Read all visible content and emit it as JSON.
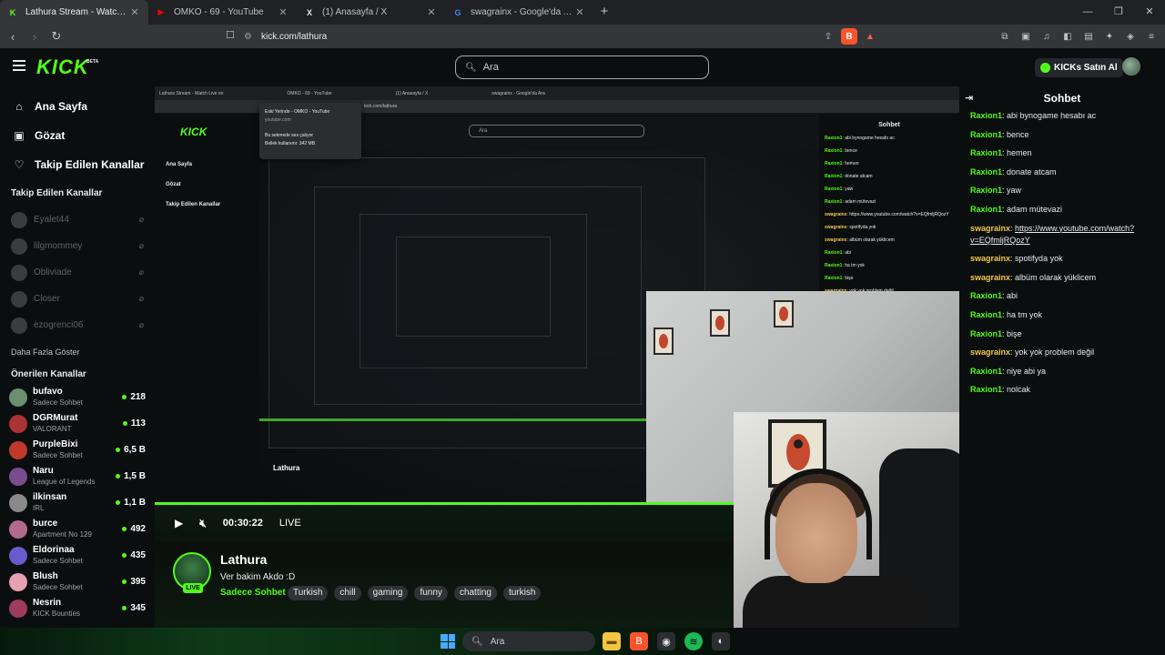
{
  "browser": {
    "tabs": [
      {
        "title": "Lathura Stream - Watch Live on",
        "favicon": "K",
        "color": "#53fc18"
      },
      {
        "title": "OMKO - 69 - YouTube",
        "favicon": "▶",
        "color": "#ff0000"
      },
      {
        "title": "(1) Anasayfa / X",
        "favicon": "X",
        "color": "#e8eaed"
      },
      {
        "title": "swagrainx - Google'da Ara",
        "favicon": "G",
        "color": "#4285f4"
      }
    ],
    "url": "kick.com/lathura"
  },
  "header": {
    "logo": "KICK",
    "beta": "BETA",
    "search_placeholder": "Ara",
    "buy_kicks": "KICKs Satın Al"
  },
  "sidebar": {
    "nav": [
      {
        "label": "Ana Sayfa",
        "icon": "home-icon"
      },
      {
        "label": "Gözat",
        "icon": "browse-icon"
      },
      {
        "label": "Takip Edilen Kanallar",
        "icon": "heart-icon"
      }
    ],
    "followed_heading": "Takip Edilen Kanallar",
    "followed": [
      "Eyalet44",
      "lilgmommey",
      "Obliviade",
      "Closer",
      "ezogrenci06"
    ],
    "more": "Daha Fazla Göster",
    "recommended_heading": "Önerilen Kanallar",
    "recommended": [
      {
        "name": "bufavo",
        "category": "Sadece Sohbet",
        "viewers": "218",
        "color": "#6b8f6f"
      },
      {
        "name": "DGRMurat",
        "category": "VALORANT",
        "viewers": "113",
        "color": "#a33"
      },
      {
        "name": "PurpleBixi",
        "category": "Sadece Sohbet",
        "viewers": "6,5 B",
        "color": "#c0392b"
      },
      {
        "name": "Naru",
        "category": "League of Legends",
        "viewers": "1,5 B",
        "color": "#7a4b8f"
      },
      {
        "name": "ilkinsan",
        "category": "IRL",
        "viewers": "1,1 B",
        "color": "#8a8a8a"
      },
      {
        "name": "burce",
        "category": "Apartment No 129",
        "viewers": "492",
        "color": "#b46a8c"
      },
      {
        "name": "Eldorinaa",
        "category": "Sadece Sohbet",
        "viewers": "435",
        "color": "#6a5acd"
      },
      {
        "name": "Blush",
        "category": "Sadece Sohbet",
        "viewers": "395",
        "color": "#e8a0b4"
      },
      {
        "name": "Nesrin",
        "category": "KICK Bounties",
        "viewers": "345",
        "color": "#9c3c5a"
      }
    ]
  },
  "player": {
    "time": "00:30:22",
    "live": "LIVE",
    "streamer": "Lathura",
    "title": "Ver bakim Akdo :D",
    "category": "Sadece Sohbet",
    "tags": [
      "Turkish",
      "chill",
      "gaming",
      "funny",
      "chatting",
      "turkish"
    ],
    "live_badge": "LIVE"
  },
  "nested": {
    "popup_title": "Eski Yerinde - OMKO - YouTube",
    "popup_domain": "youtube.com",
    "popup_line1": "Bu sekmede ses çalıyor",
    "popup_line2": "Bellek kullanımı: 342 MB"
  },
  "chat": {
    "title": "Sohbet",
    "messages": [
      {
        "user": "Raxion1",
        "text": "abi bynogame hesabı ac"
      },
      {
        "user": "Raxion1",
        "text": "bence"
      },
      {
        "user": "Raxion1",
        "text": "hemen"
      },
      {
        "user": "Raxion1",
        "text": "donate atcam"
      },
      {
        "user": "Raxion1",
        "text": "yaw"
      },
      {
        "user": "Raxion1",
        "text": "adam mütevazi"
      },
      {
        "user": "swagrainx",
        "text": "",
        "link": "https://www.youtube.com/watch?v=EQfmljRQozY"
      },
      {
        "user": "swagrainx",
        "text": "spotifyda yok"
      },
      {
        "user": "swagrainx",
        "text": "albüm olarak yüklicem"
      },
      {
        "user": "Raxion1",
        "text": "abi"
      },
      {
        "user": "Raxion1",
        "text": "ha tm yok"
      },
      {
        "user": "Raxion1",
        "text": "bişe"
      },
      {
        "user": "swagrainx",
        "text": "yok yok problem değil"
      },
      {
        "user": "Raxion1",
        "text": "niye abi ya"
      },
      {
        "user": "Raxion1",
        "text": "nolcak"
      }
    ]
  },
  "taskbar": {
    "search": "Ara"
  }
}
